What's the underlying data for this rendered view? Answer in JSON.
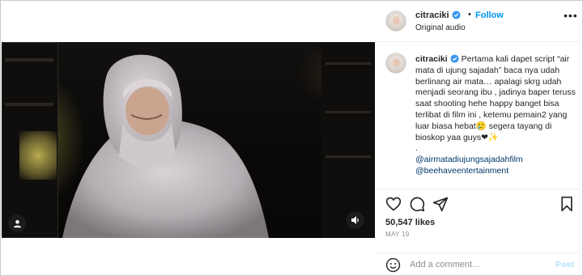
{
  "post": {
    "username": "citraciki",
    "follow_label": "Follow",
    "separator": "•",
    "audio_label": "Original audio",
    "more_label": "•••"
  },
  "caption": {
    "username": "citraciki",
    "text": "Pertama kali dapet script “air mata di ujung sajadah” baca nya udah berlinang air mata… apalagi skrg udah menjadi seorang ibu , jadinya baper teruss saat shooting hehe happy banget bisa terlibat di film ini , ketemu pemain2 yang luar biasa hebat🥲 segera tayang di bioskop yaa guys❤✨\n.",
    "tags": [
      "@airmatadiujungsajadahfilm",
      "@beehaveentertainment"
    ]
  },
  "engagement": {
    "likes": "50,547 likes",
    "date": "MAY 19"
  },
  "comment_box": {
    "placeholder": "Add a comment...",
    "post_label": "Post"
  },
  "icons": {
    "verified": "verified-badge-icon",
    "like": "heart-icon",
    "comment": "comment-icon",
    "share": "share-icon",
    "save": "bookmark-icon",
    "emoji": "emoji-icon",
    "tagged_people": "person-icon",
    "audio": "speaker-icon",
    "more": "more-options-icon"
  },
  "colors": {
    "accent": "#0095f6",
    "verified": "#3897f0",
    "tag_link": "#00376b",
    "muted": "#8e8e8e",
    "post_disabled": "#b2dffc"
  }
}
